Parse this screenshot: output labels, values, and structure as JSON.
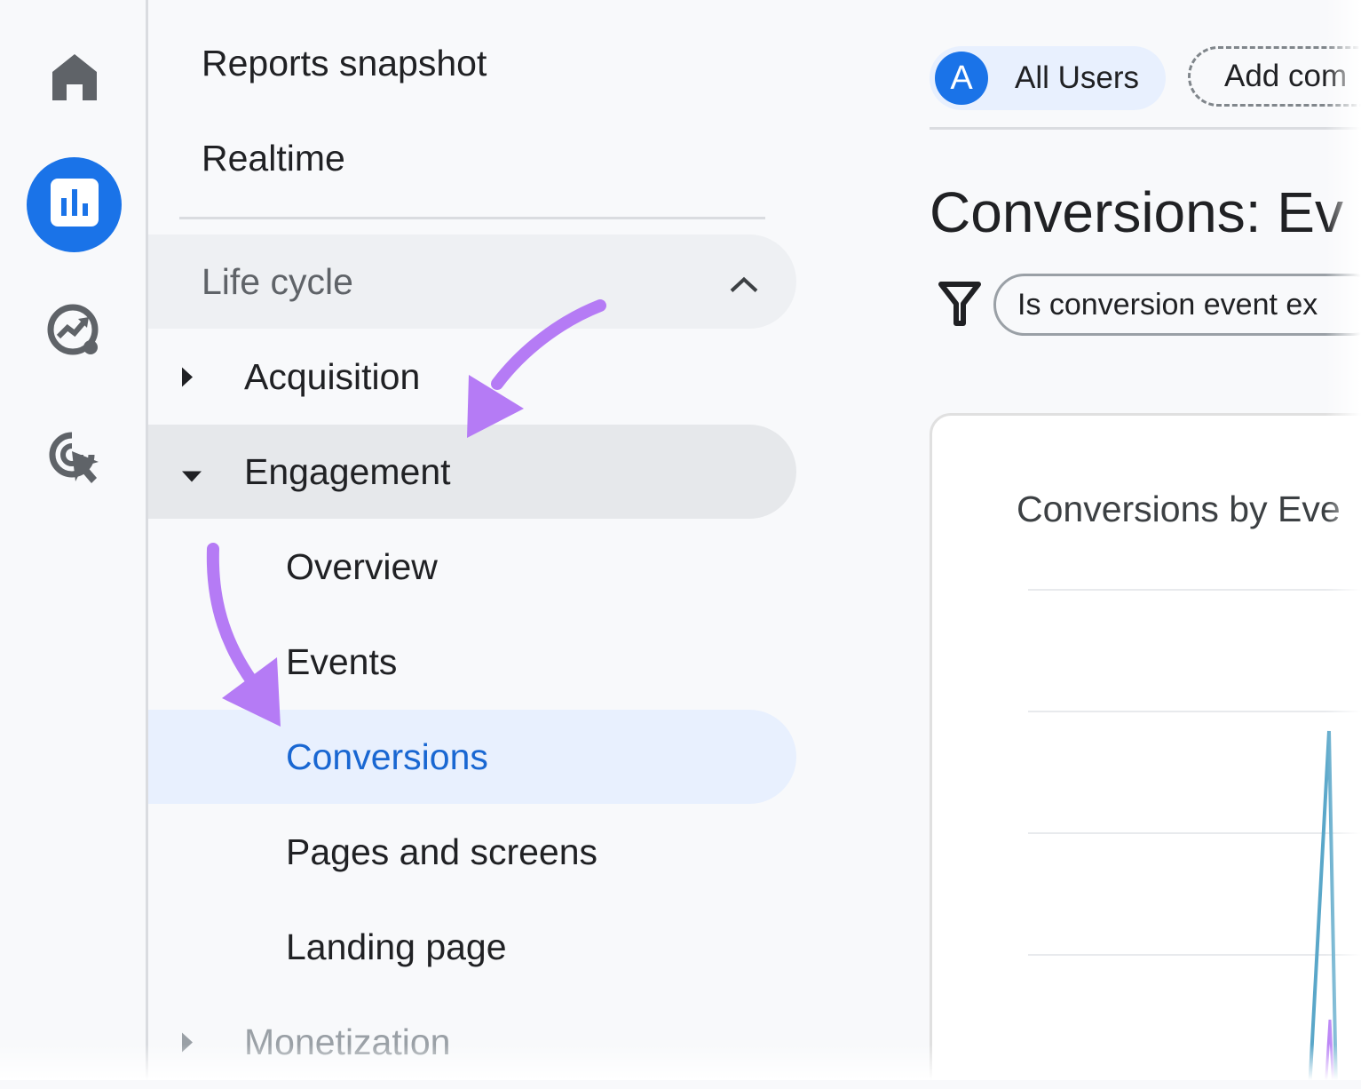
{
  "nav": {
    "reports_snapshot": "Reports snapshot",
    "realtime": "Realtime",
    "section_title": "Life cycle",
    "items": [
      {
        "label": "Acquisition"
      },
      {
        "label": "Engagement"
      },
      {
        "label": "Monetization"
      }
    ],
    "sub_items": [
      {
        "label": "Overview"
      },
      {
        "label": "Events"
      },
      {
        "label": "Conversions"
      },
      {
        "label": "Pages and screens"
      },
      {
        "label": "Landing page"
      }
    ],
    "selected_color": "#1967d2"
  },
  "rail": {
    "icons": [
      "home-icon",
      "reports-icon",
      "explore-icon",
      "advertising-icon"
    ],
    "active_color": "#1a73e8"
  },
  "header": {
    "avatar_letter": "A",
    "segment_label": "All Users",
    "add_comparison_label": "Add com"
  },
  "main": {
    "title": "Conversions: Ev",
    "filter_text": "Is conversion event ex",
    "card_title": "Conversions by Eve"
  },
  "annotation": {
    "arrow_color": "#b57bf5"
  }
}
